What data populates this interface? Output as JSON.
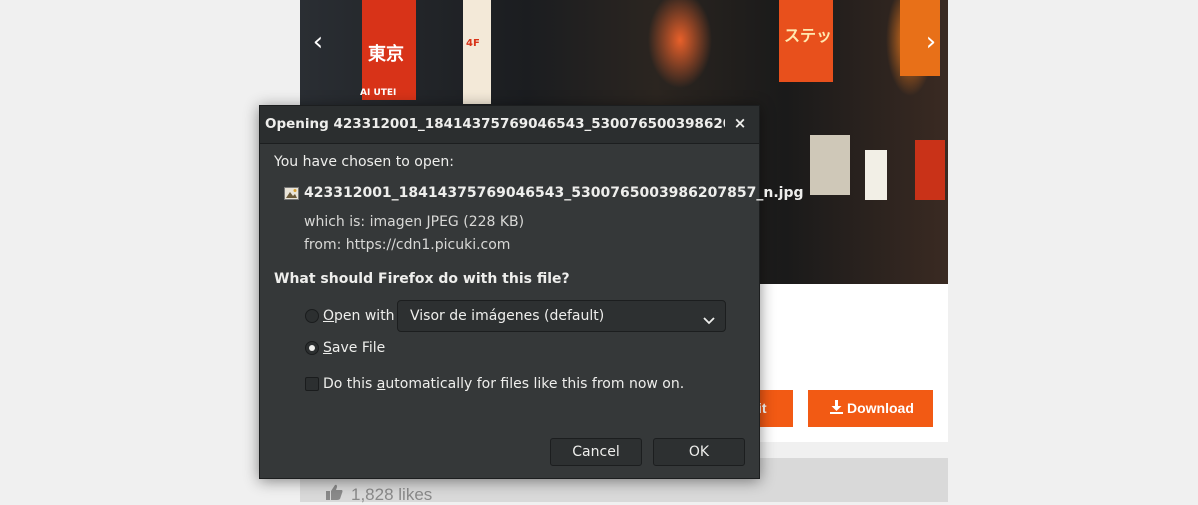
{
  "page": {
    "prev_arrow": "‹",
    "next_arrow": "›",
    "edit_button_visible_text": "it",
    "download_button": "Download",
    "likes_count": "1,828 likes",
    "photo_signs": [
      "東京",
      "AI UTEI",
      "ステッ",
      "4F"
    ]
  },
  "dialog": {
    "title": "Opening 423312001_18414375769046543_5300765003986207857_...",
    "close_label": "×",
    "chosen_to_open": "You have chosen to open:",
    "filename": "423312001_18414375769046543_5300765003986207857_n.jpg",
    "which_is": "which is:  imagen JPEG (228 KB)",
    "from": "from:  https://cdn1.picuki.com",
    "question": "What should Firefox do with this file?",
    "open_with_label": "Open with",
    "open_with_mnemonic": "O",
    "open_with_rest": "pen with",
    "open_with_app": "Visor de imágenes (default)",
    "save_file_mnemonic": "S",
    "save_file_rest": "ave File",
    "auto_pre": "Do this ",
    "auto_mnemonic": "a",
    "auto_post": "utomatically for files like this from now on.",
    "cancel": "Cancel",
    "ok": "OK",
    "selected_option": "Save File",
    "auto_checked": false
  },
  "colors": {
    "accent_orange": "#f25a14",
    "dialog_bg": "#353839",
    "page_bg": "#f0f0f0"
  }
}
